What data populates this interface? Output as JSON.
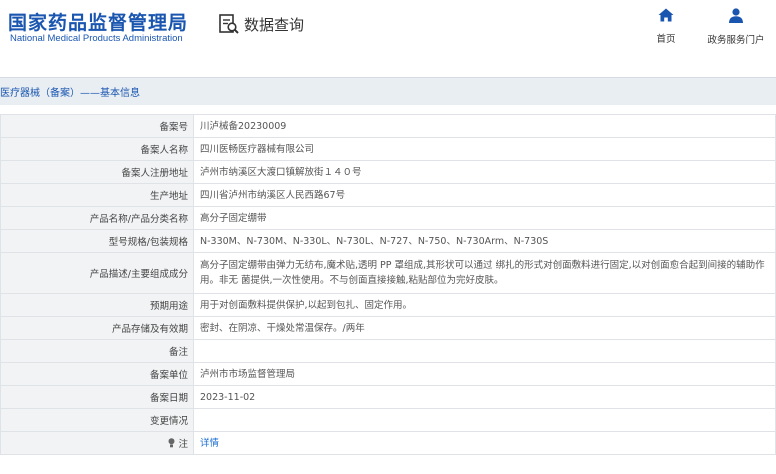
{
  "header": {
    "logo_cn": "国家药品监督管理局",
    "logo_en": "National Medical Products Administration",
    "query_title": "数据查询",
    "query_icon": "document-search-icon",
    "nav": [
      {
        "label": "首页",
        "icon": "home-icon"
      },
      {
        "label": "政务服务门户",
        "icon": "user-icon"
      }
    ]
  },
  "breadcrumb": {
    "text": "医疗器械（备案）——基本信息"
  },
  "record": {
    "rows": [
      {
        "label": "备案号",
        "value": "川泸械备20230009"
      },
      {
        "label": "备案人名称",
        "value": "四川医畅医疗器械有限公司"
      },
      {
        "label": "备案人注册地址",
        "value": "泸州市纳溪区大渡口镇解放街１４０号"
      },
      {
        "label": "生产地址",
        "value": "四川省泸州市纳溪区人民西路67号"
      },
      {
        "label": "产品名称/产品分类名称",
        "value": "高分子固定绷带"
      },
      {
        "label": "型号规格/包装规格",
        "value": "N-330M、N-730M、N-330L、N-730L、N-727、N-750、N-730Arm、N-730S"
      },
      {
        "label": "产品描述/主要组成成分",
        "value": "高分子固定绷带由弹力无纺布,魔术贴,透明 PP 罩组成,其形状可以通过 绑扎的形式对创面敷料进行固定,以对创面愈合起到间接的辅助作用。非无 菌提供,一次性使用。不与创面直接接触,粘贴部位为完好皮肤。"
      },
      {
        "label": "预期用途",
        "value": "用于对创面敷料提供保护,以起到包扎、固定作用。"
      },
      {
        "label": "产品存储及有效期",
        "value": "密封、在阴凉、干燥处常温保存。/两年"
      },
      {
        "label": "备注",
        "value": ""
      },
      {
        "label": "备案单位",
        "value": "泸州市市场监督管理局"
      },
      {
        "label": "备案日期",
        "value": "2023-11-02"
      },
      {
        "label": "变更情况",
        "value": ""
      },
      {
        "label": "注",
        "value": "详情",
        "icon": "bulb-icon"
      }
    ]
  },
  "colors": {
    "brand_blue": "#1a56b0",
    "link_blue": "#1a6dd0",
    "label_bg": "#f2f3f5",
    "band_bg": "#e9eef3"
  }
}
